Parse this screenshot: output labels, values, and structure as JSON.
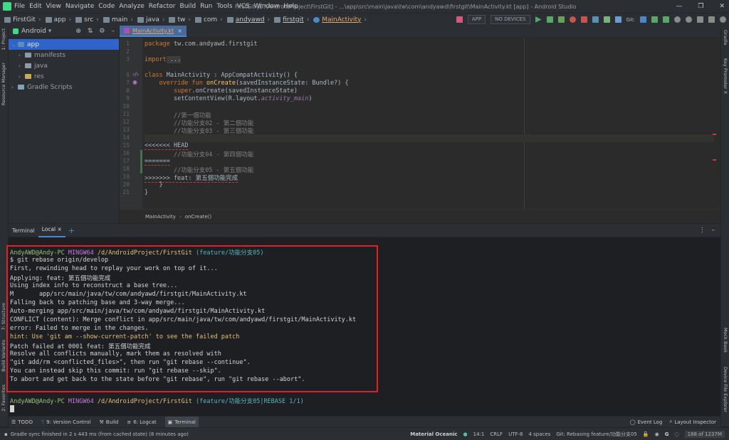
{
  "colors": {
    "accent": "#4a88c7",
    "error_box": "#e0202a",
    "selection": "#2f65ca"
  },
  "titlebar": {
    "menu": [
      "File",
      "Edit",
      "View",
      "Navigate",
      "Code",
      "Analyze",
      "Refactor",
      "Build",
      "Run",
      "Tools",
      "VCS",
      "Window",
      "Help"
    ],
    "window_title": "FirstGit [D:\\AndroidProject\\FirstGit] - ...\\app\\src\\main\\java\\tw\\com\\andyawd\\firstgit\\MainActivity.kt [app] - Android Studio",
    "controls": [
      "—",
      "❐",
      "✕"
    ]
  },
  "navbar": {
    "crumbs": [
      "FirstGit",
      "app",
      "src",
      "main",
      "java",
      "tw",
      "com",
      "andyawd",
      "firstgit",
      "MainActivity"
    ],
    "config": "APP",
    "devices": "NO DEVICES",
    "git_label": "Git:"
  },
  "project": {
    "view": "Android",
    "tree": [
      {
        "label": "app",
        "level": 0,
        "selected": true,
        "expanded": true
      },
      {
        "label": "manifests",
        "level": 1
      },
      {
        "label": "java",
        "level": 1
      },
      {
        "label": "res",
        "level": 1
      },
      {
        "label": "Gradle Scripts",
        "level": 0
      }
    ]
  },
  "left_tabs": {
    "project": "1: Project",
    "resource": "Resource Manager",
    "structure": "7: Structure",
    "variants": "Build Variants",
    "favorites": "2: Favorites"
  },
  "right_tabs": {
    "gradle": "Gradle",
    "key": "Key Promoter X",
    "mockbook": "Mock Book",
    "device": "Device File Explorer"
  },
  "editor": {
    "tab": "MainActivity.kt",
    "lines": [
      "1",
      "2",
      "3",
      "6",
      "7",
      "8",
      "9",
      "10",
      "11",
      "12",
      "13",
      "14",
      "15",
      "16",
      "17",
      "18",
      "19",
      "20",
      "21"
    ],
    "code": {
      "l1_kw": "package",
      "l1_rest": " tw.com.andyawd.firstgit",
      "l3_kw": "import",
      "l3_rest": " ...",
      "l6_kw": "class",
      "l6_rest": " MainActivity : AppCompatActivity() {",
      "l7_kw": "override fun",
      "l7_fn": " onCreate",
      "l7_rest": "(savedInstanceState: Bundle?) {",
      "l8_kw": "super",
      "l8_rest": ".onCreate(savedInstanceState)",
      "l9_rest": "setContentView(R.layout.",
      "l9_it": "activity_main",
      "l9_end": ")",
      "l11": "//第一個功能",
      "l12": "//功能分支02 - 第二個功能",
      "l13": "//功能分支03 - 第三個功能",
      "l15": "<<<<<<< HEAD",
      "l16": "//功能分支04 - 第四個功能",
      "l17": "=======",
      "l18": "//功能分支05 - 第五個功能",
      "l19": ">>>>>>> feat: 第五個功能完成",
      "l20": "}",
      "l21": "}"
    },
    "breadcrumb": [
      "MainActivity",
      "onCreate()"
    ]
  },
  "terminal": {
    "tabs": [
      "Terminal",
      "Local"
    ],
    "lines": {
      "prompt1_user": "AndyAWD@Andy-PC",
      "prompt1_sys": "MINGW64",
      "prompt1_path": "/d/AndroidProject/FirstGit",
      "prompt1_branch": "(feature/功能分支05)",
      "cmd": "$ git rebase origin/develop",
      "o1": "First, rewinding head to replay your work on top of it...",
      "o2": "Applying: feat: 第五個功能完成",
      "o3": "Using index info to reconstruct a base tree...",
      "o4": "M       app/src/main/java/tw/com/andyawd/firstgit/MainActivity.kt",
      "o5": "Falling back to patching base and 3-way merge...",
      "o6": "Auto-merging app/src/main/java/tw/com/andyawd/firstgit/MainActivity.kt",
      "o7": "CONFLICT (content): Merge conflict in app/src/main/java/tw/com/andyawd/firstgit/MainActivity.kt",
      "o8": "error: Failed to merge in the changes.",
      "o9": "hint: Use 'git am --show-current-patch' to see the failed patch",
      "o10": "Patch failed at 0001 feat: 第五個功能完成",
      "o11": "Resolve all conflicts manually, mark them as resolved with",
      "o12": "\"git add/rm <conflicted_files>\", then run \"git rebase --continue\".",
      "o13": "You can instead skip this commit: run \"git rebase --skip\".",
      "o14": "To abort and get back to the state before \"git rebase\", run \"git rebase --abort\".",
      "prompt2_user": "AndyAWD@Andy-PC",
      "prompt2_sys": "MINGW64",
      "prompt2_path": "/d/AndroidProject/FirstGit",
      "prompt2_branch": "(feature/功能分支05|REBASE 1/1)",
      "prompt2_cmd": "$"
    }
  },
  "bottombar": {
    "tools": [
      "TODO",
      "9: Version Control",
      "Build",
      "6: Logcat",
      "Terminal"
    ],
    "right": [
      "Event Log",
      "Layout Inspector"
    ]
  },
  "statusbar": {
    "message": "Gradle sync finished in 2 s 443 ms (from cached state) (8 minutes ago)",
    "theme": "Material Oceanic",
    "position": "14:1",
    "line_sep": "CRLF",
    "encoding": "UTF-8",
    "indent": "4 spaces",
    "git": "Git: Rebasing feature/功能分支05",
    "memory": "188 of 1237M"
  }
}
